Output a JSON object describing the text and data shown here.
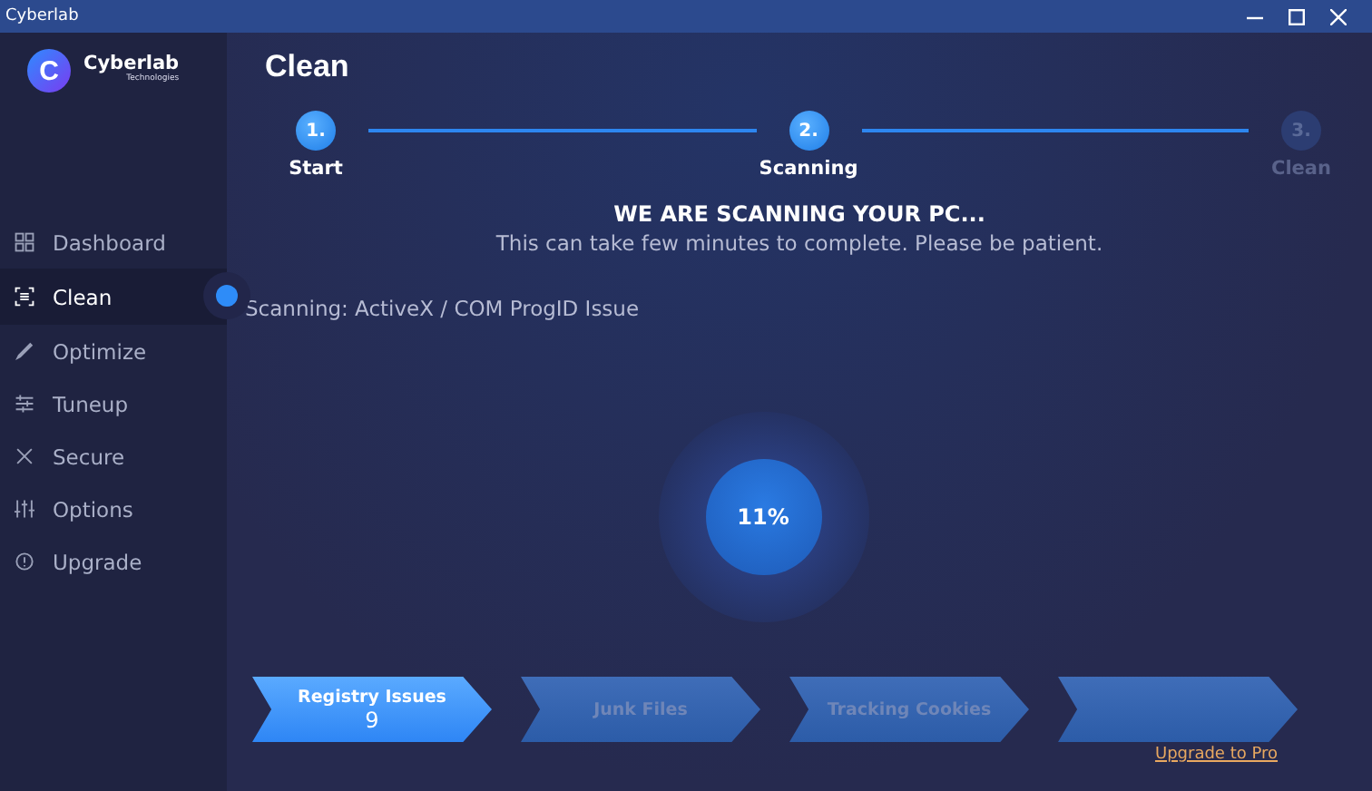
{
  "window": {
    "title": "Cyberlab"
  },
  "brand": {
    "name": "Cyberlab",
    "tagline": "Technologies",
    "letter": "C"
  },
  "sidebar": {
    "items": [
      {
        "label": "Dashboard",
        "selected": false
      },
      {
        "label": "Clean",
        "selected": true
      },
      {
        "label": "Optimize",
        "selected": false
      },
      {
        "label": "Tuneup",
        "selected": false
      },
      {
        "label": "Secure",
        "selected": false
      },
      {
        "label": "Options",
        "selected": false
      },
      {
        "label": "Upgrade",
        "selected": false
      }
    ]
  },
  "page_title": "Clean",
  "steps": [
    {
      "number": "1.",
      "label": "Start",
      "reached": true
    },
    {
      "number": "2.",
      "label": "Scanning",
      "reached": true
    },
    {
      "number": "3.",
      "label": "Clean",
      "reached": false
    }
  ],
  "heading": "WE ARE SCANNING YOUR PC...",
  "subheading": "This can take few minutes to complete. Please be patient.",
  "scan_status": "Scanning: ActiveX / COM ProgID Issue",
  "progress_label": "11%",
  "categories": [
    {
      "label": "Registry Issues",
      "count": "9",
      "selected": true
    },
    {
      "label": "Junk Files",
      "selected": false
    },
    {
      "label": "Tracking Cookies",
      "selected": false
    },
    {
      "selected": false
    }
  ],
  "upgrade_link": "Upgrade to Pro"
}
